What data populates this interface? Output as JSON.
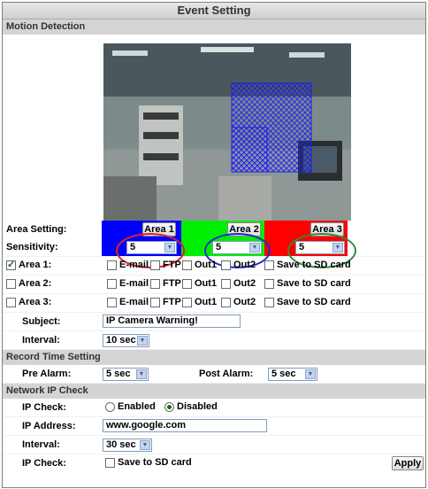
{
  "title": "Event Setting",
  "motion": {
    "section_label": "Motion Detection",
    "area_setting_label": "Area Setting:",
    "sensitivity_label": "Sensitivity:",
    "areas": [
      {
        "button": "Area 1",
        "sensitivity": "5",
        "color": "#0000ff"
      },
      {
        "button": "Area 2",
        "sensitivity": "5",
        "color": "#00ee00"
      },
      {
        "button": "Area 3",
        "sensitivity": "5",
        "color": "#ff0000"
      }
    ],
    "rows": [
      {
        "label": "Area 1:",
        "checked": true
      },
      {
        "label": "Area 2:",
        "checked": false
      },
      {
        "label": "Area 3:",
        "checked": false
      }
    ],
    "actions": {
      "email": "E-mail",
      "ftp": "FTP",
      "out1": "Out1",
      "out2": "Out2",
      "sd": "Save to SD card"
    },
    "subject_label": "Subject:",
    "subject_value": "IP Camera Warning!",
    "interval_label": "Interval:",
    "interval_value": "10 sec"
  },
  "record": {
    "section_label": "Record Time Setting",
    "pre_label": "Pre Alarm:",
    "pre_value": "5 sec",
    "post_label": "Post Alarm:",
    "post_value": "5 sec"
  },
  "network": {
    "section_label": "Network IP Check",
    "ip_check_label": "IP Check:",
    "enabled_label": "Enabled",
    "disabled_label": "Disabled",
    "selected": "Disabled",
    "address_label": "IP Address:",
    "address_value": "www.google.com",
    "interval_label": "Interval:",
    "interval_value": "30 sec",
    "ip_check2_label": "IP Check:",
    "save_sd_label": "Save to SD card",
    "apply_label": "Apply"
  },
  "colors": {
    "annotation_red": "#e0202a",
    "annotation_blue": "#1a2bd0",
    "annotation_green": "#2e8b3e"
  }
}
